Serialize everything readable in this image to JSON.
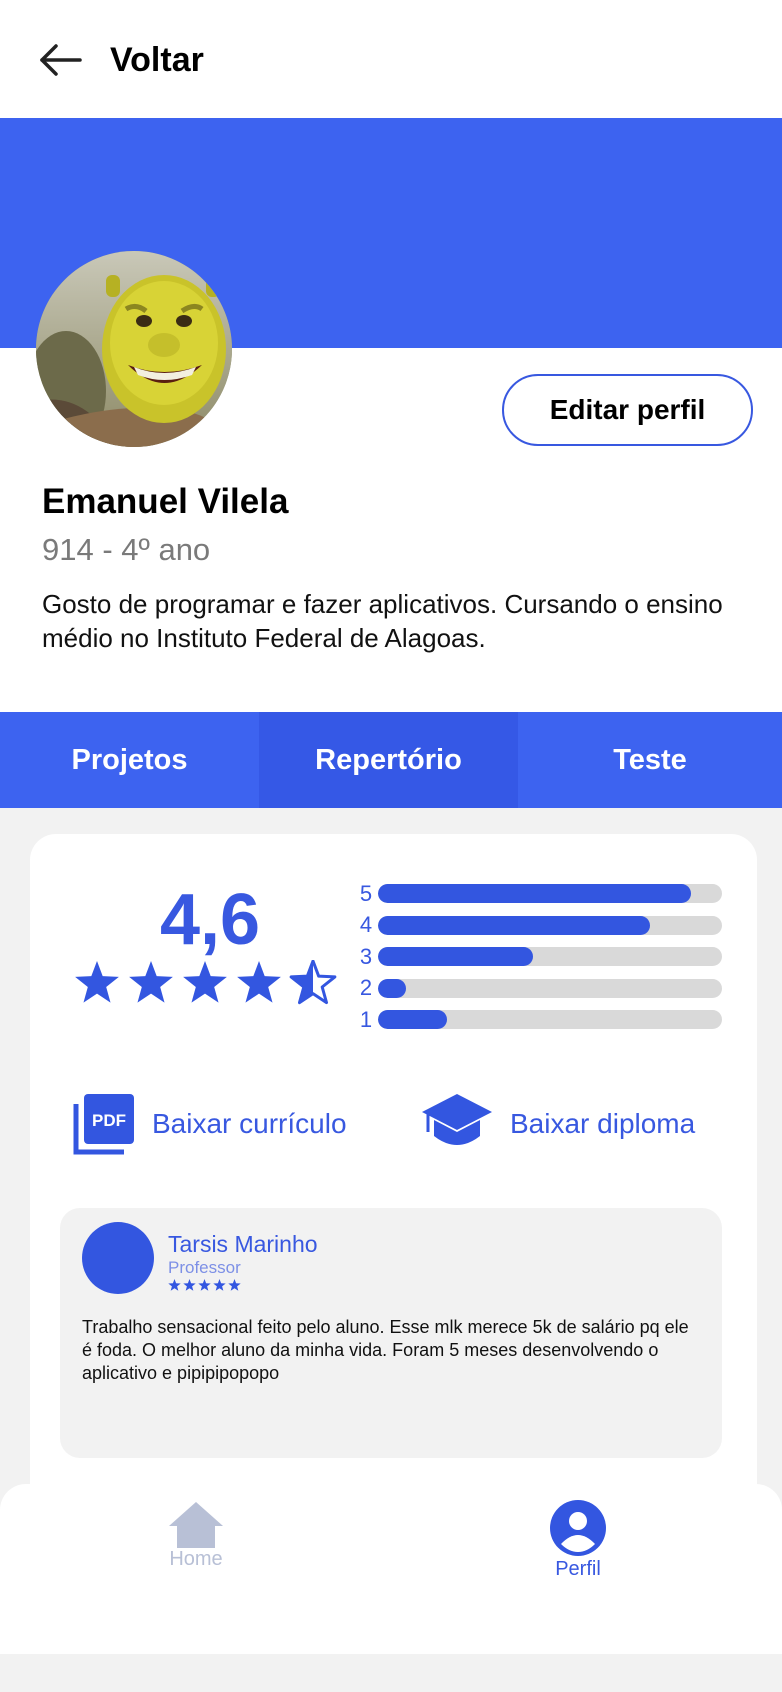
{
  "header": {
    "back_label": "Voltar"
  },
  "profile": {
    "name": "Emanuel Vilela",
    "meta": "914 - 4º ano",
    "bio": "Gosto de programar e fazer aplicativos. Cursando o ensino médio no Instituto Federal de Alagoas.",
    "edit_label": "Editar perfil"
  },
  "tabs": [
    {
      "label": "Projetos"
    },
    {
      "label": "Repertório",
      "active": true
    },
    {
      "label": "Teste"
    }
  ],
  "rating": {
    "average": "4,6",
    "stars_value": 4.5,
    "distribution": [
      {
        "label": "5",
        "fraction": 0.91
      },
      {
        "label": "4",
        "fraction": 0.79
      },
      {
        "label": "3",
        "fraction": 0.45
      },
      {
        "label": "2",
        "fraction": 0.08
      },
      {
        "label": "1",
        "fraction": 0.2
      }
    ]
  },
  "downloads": {
    "cv_label": "Baixar currículo",
    "diploma_label": "Baixar diploma",
    "pdf_icon_text": "PDF"
  },
  "review": {
    "author": "Tarsis Marinho",
    "role": "Professor",
    "stars": 5,
    "text": "Trabalho sensacional feito pelo aluno. Esse mlk merece 5k de salário pq ele é foda. O melhor aluno da minha vida. Foram 5 meses desenvolvendo o aplicativo e pipipipopopo"
  },
  "nav": {
    "home_label": "Home",
    "profile_label": "Perfil"
  },
  "colors": {
    "accent": "#3d63f0",
    "accent_dark": "#3558e6",
    "bar_track": "#d9d9d9",
    "nav_inactive": "#b8c0d6"
  }
}
